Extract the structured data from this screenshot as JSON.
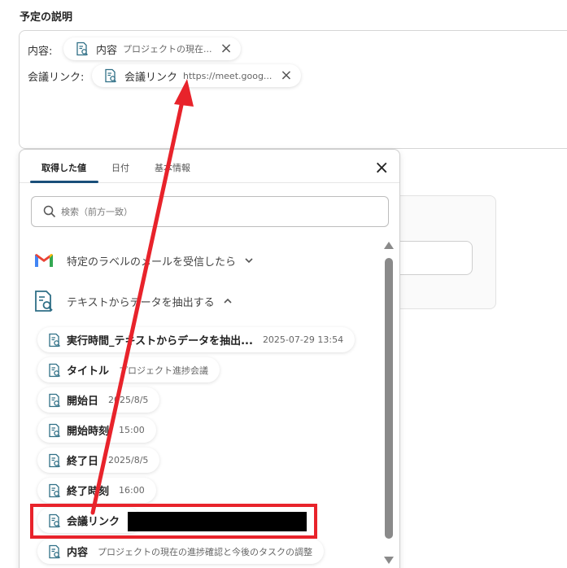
{
  "section_title": "予定の説明",
  "description": {
    "lines": [
      {
        "label": "内容:",
        "chip_name": "内容",
        "chip_value": "プロジェクトの現在..."
      },
      {
        "label": "会議リンク:",
        "chip_name": "会議リンク",
        "chip_value": "https://meet.goog..."
      }
    ]
  },
  "panel": {
    "tabs": [
      "取得した値",
      "日付",
      "基本情報"
    ],
    "active_tab": 0,
    "search_placeholder": "検索（前方一致）",
    "groups": [
      {
        "title": "特定のラベルのメールを受信したら",
        "icon": "gmail-icon",
        "expanded": false
      },
      {
        "title": "テキストからデータを抽出する",
        "icon": "extract-doc-icon",
        "expanded": true
      }
    ],
    "items": [
      {
        "name": "実行時間_テキストからデータを抽出...",
        "value": "2025-07-29 13:54"
      },
      {
        "name": "タイトル",
        "value": "プロジェクト進捗会議"
      },
      {
        "name": "開始日",
        "value": "2025/8/5"
      },
      {
        "name": "開始時刻",
        "value": "15:00"
      },
      {
        "name": "終了日",
        "value": "2025/8/5"
      },
      {
        "name": "終了時刻",
        "value": "16:00"
      },
      {
        "name": "会議リンク",
        "value": ""
      },
      {
        "name": "内容",
        "value": "プロジェクトの現在の進捗確認と今後のタスクの調整"
      }
    ]
  },
  "colors": {
    "annotation": "#e8232b",
    "tab_underline": "#1a4f7a"
  }
}
